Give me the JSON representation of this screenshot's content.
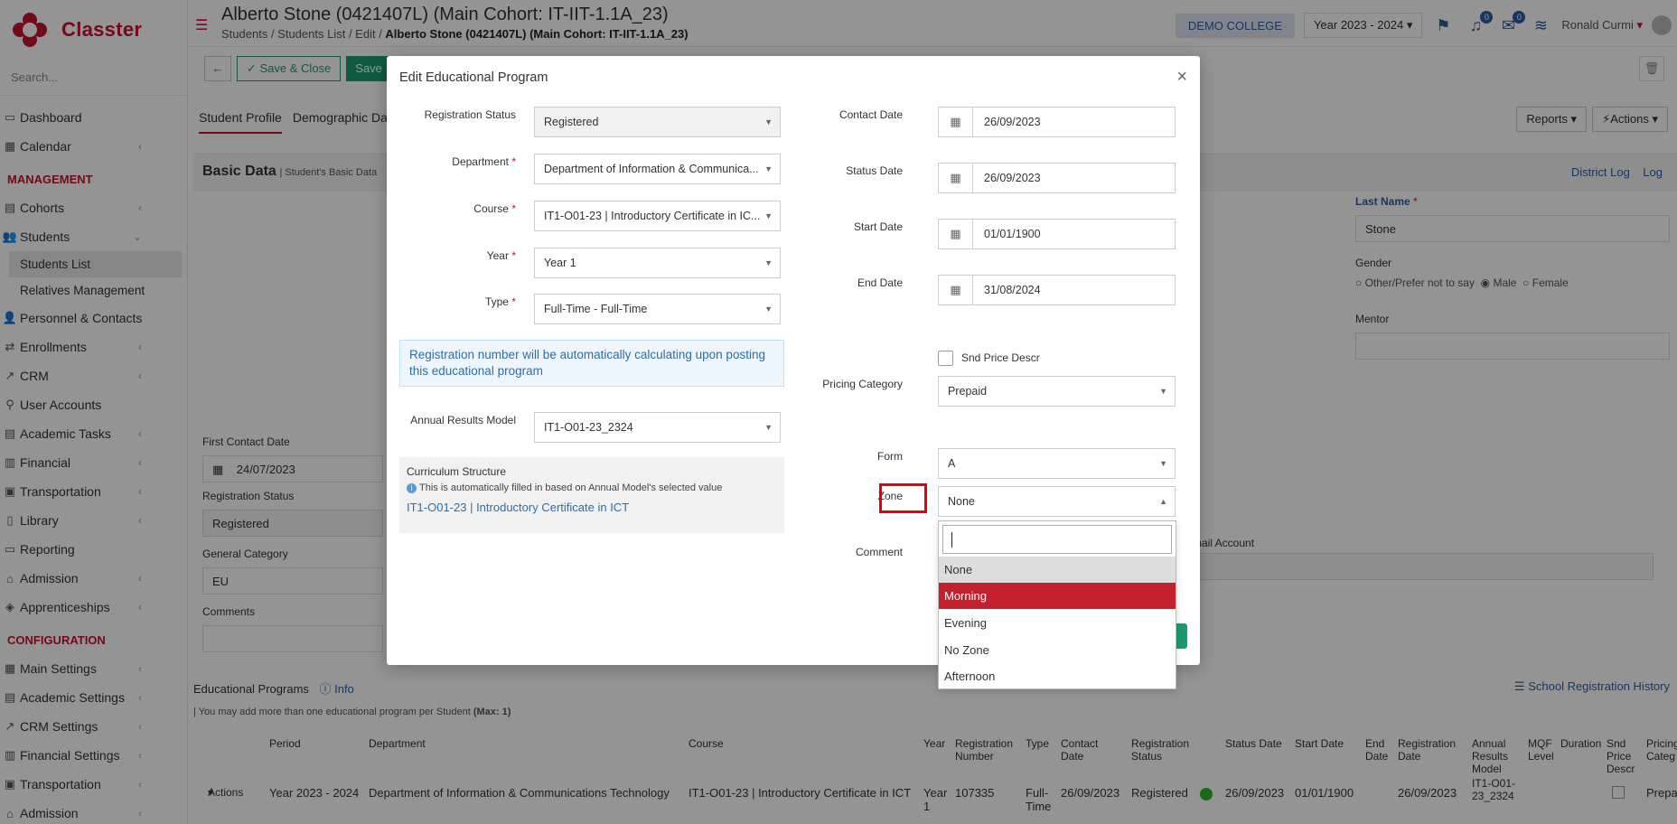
{
  "app": {
    "name": "Classter"
  },
  "sidebar": {
    "search_placeholder": "Search...",
    "items_top": [
      {
        "label": "Dashboard",
        "icon": "dashboard-icon"
      },
      {
        "label": "Calendar",
        "icon": "calendar-icon"
      }
    ],
    "section_management": "MANAGEMENT",
    "cohorts": "Cohorts",
    "students": "Students",
    "students_list": "Students List",
    "relatives": "Relatives Management",
    "items_mgmt": [
      "Personnel & Contacts",
      "Enrollments",
      "CRM",
      "User Accounts",
      "Academic Tasks",
      "Financial",
      "Transportation",
      "Library",
      "Reporting",
      "Admission",
      "Apprenticeships"
    ],
    "section_config": "CONFIGURATION",
    "items_config": [
      "Main Settings",
      "Academic Settings",
      "CRM Settings",
      "Financial Settings",
      "Transportation",
      "Admission"
    ]
  },
  "header": {
    "title": "Alberto Stone (0421407L) (Main Cohort: IT-IIT-1.1A_23)",
    "crumbs": [
      "Students",
      "Students List",
      "Edit"
    ],
    "crumb_current": "Alberto Stone (0421407L) (Main Cohort: IT-IIT-1.1A_23)",
    "college": "DEMO COLLEGE",
    "year": "Year 2023 - 2024",
    "notif_count": "0",
    "msg_count": "0",
    "user": "Ronald Curmi"
  },
  "toolbar": {
    "save_close": "Save & Close",
    "save": "Save"
  },
  "tabs": {
    "profile": "Student Profile",
    "demographic": "Demographic Da"
  },
  "right_buttons": {
    "reports": "Reports",
    "actions": "Actions"
  },
  "basic": {
    "title": "Basic Data",
    "subtitle": "| Student's Basic Data",
    "district_log": "District Log",
    "log": "Log",
    "last_name_label": "Last Name",
    "last_name": "Stone",
    "gender_label": "Gender",
    "gender_opts": [
      "Other/Prefer not to say",
      "Male",
      "Female"
    ],
    "mentor_label": "Mentor",
    "first_contact_label": "First Contact Date",
    "first_contact": "24/07/2023",
    "reg_status_label": "Registration Status",
    "reg_status": "Registered",
    "gen_cat_label": "General Category",
    "gen_cat": "EU",
    "comments_label": "Comments",
    "email_label": "mail Account"
  },
  "programs": {
    "title": "Educational Programs",
    "info": "Info",
    "note": "| You may add more than one educational program per Student ",
    "note_bold": "(Max: 1)",
    "history": "School Registration History",
    "columns": [
      "Period",
      "Department",
      "Course",
      "Year",
      "Registration Number",
      "Type",
      "Contact Date",
      "Registration Status",
      "Status Date",
      "Start Date",
      "End Date",
      "Registration Date",
      "Annual Results Model",
      "MQF Level",
      "Duration",
      "Snd Price Descr",
      "Pricing Categ"
    ],
    "row": {
      "actions": "Actions",
      "period": "Year 2023 - 2024",
      "department": "Department of Information & Communications Technology",
      "course": "IT1-O01-23 | Introductory Certificate in ICT",
      "year": "Year 1",
      "reg_no": "107335",
      "type": "Full-Time",
      "contact": "26/09/2023",
      "status": "Registered",
      "status_date": "26/09/2023",
      "start": "01/01/1900",
      "reg_date": "26/09/2023",
      "arm": "IT1-O01-23_2324",
      "pricing": "Prepa"
    }
  },
  "modal": {
    "title": "Edit Educational Program",
    "registration_status": {
      "label": "Registration Status",
      "value": "Registered"
    },
    "department": {
      "label": "Department",
      "value": "Department of Information & Communica..."
    },
    "course": {
      "label": "Course",
      "value": "IT1-O01-23 | Introductory Certificate in IC..."
    },
    "year": {
      "label": "Year",
      "value": "Year 1"
    },
    "type": {
      "label": "Type",
      "value": "Full-Time - Full-Time"
    },
    "info_text": "Registration number will be automatically calculating upon posting this educational program",
    "annual_results": {
      "label": "Annual Results Model",
      "value": "IT1-O01-23_2324"
    },
    "curriculum": {
      "title": "Curriculum Structure",
      "note": "This is automatically filled in based on Annual Model's selected value",
      "link": "IT1-O01-23 | Introductory Certificate in ICT"
    },
    "contact_date": {
      "label": "Contact Date",
      "value": "26/09/2023"
    },
    "status_date": {
      "label": "Status Date",
      "value": "26/09/2023"
    },
    "start_date": {
      "label": "Start Date",
      "value": "01/01/1900"
    },
    "end_date": {
      "label": "End Date",
      "value": "31/08/2024"
    },
    "snd_price": {
      "label": "Snd Price Descr",
      "checked": false
    },
    "pricing": {
      "label": "Pricing Category",
      "value": "Prepaid"
    },
    "form": {
      "label": "Form",
      "value": "A"
    },
    "zone": {
      "label": "Zone",
      "value": "None"
    },
    "comment": {
      "label": "Comment"
    },
    "zone_options": [
      "None",
      "Morning",
      "Evening",
      "No Zone",
      "Afternoon"
    ],
    "zone_selected": "None",
    "zone_highlighted": "Morning"
  },
  "colors": {
    "brand": "#c8102e",
    "green": "#1a9b72",
    "link": "#2c5ea8",
    "highlight": "#c21f2f"
  }
}
